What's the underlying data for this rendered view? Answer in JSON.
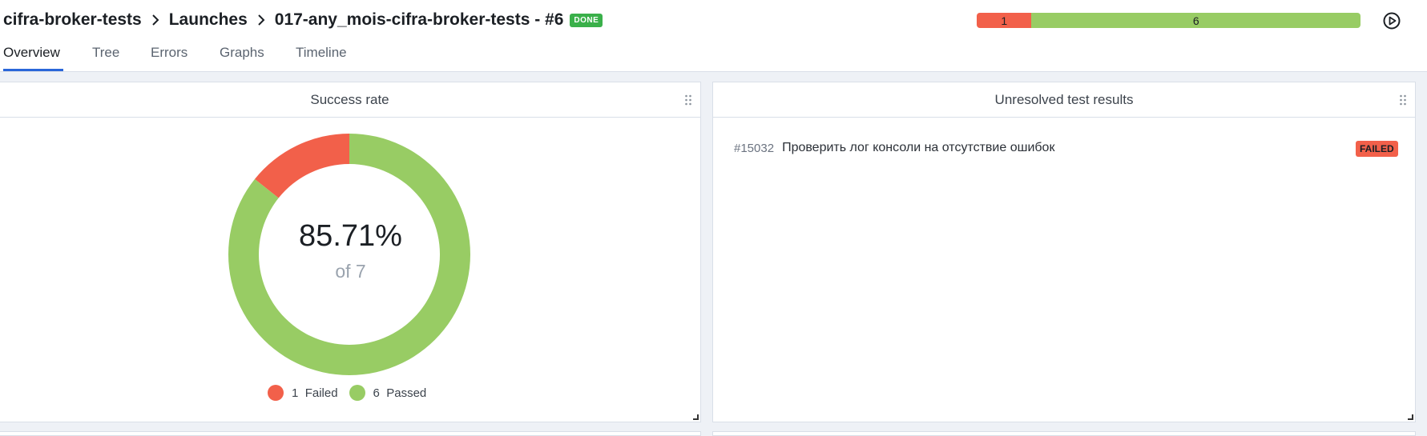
{
  "breadcrumb": {
    "project": "cifra-broker-tests",
    "section": "Launches",
    "launch": "017-any_mois-cifra-broker-tests - #6",
    "status_badge": "DONE"
  },
  "status_bar": {
    "failed_count": "1",
    "passed_count": "6",
    "failed_fraction": 0.1429,
    "colors": {
      "failed": "#f2604a",
      "passed": "#98cc64"
    }
  },
  "tabs": [
    {
      "label": "Overview",
      "active": true
    },
    {
      "label": "Tree"
    },
    {
      "label": "Errors"
    },
    {
      "label": "Graphs"
    },
    {
      "label": "Timeline"
    }
  ],
  "success_rate": {
    "title": "Success rate",
    "value": "85.71%",
    "subtitle": "of 7",
    "chart_data": {
      "type": "pie",
      "categories": [
        "Failed",
        "Passed"
      ],
      "values": [
        1,
        6
      ],
      "colors": [
        "#f2604a",
        "#98cc64"
      ]
    },
    "legend": [
      {
        "count": "1",
        "label": "Failed"
      },
      {
        "count": "6",
        "label": "Passed"
      }
    ]
  },
  "unresolved": {
    "title": "Unresolved test results",
    "items": [
      {
        "id": "#15032",
        "name": "Проверить лог консоли на отсутствие ошибок",
        "status": "FAILED"
      }
    ]
  },
  "icons": {
    "play": "play-circle-icon",
    "drag": "drag-handle-icon",
    "resize": "resize-corner-icon",
    "separator": "chevron-right-icon"
  }
}
